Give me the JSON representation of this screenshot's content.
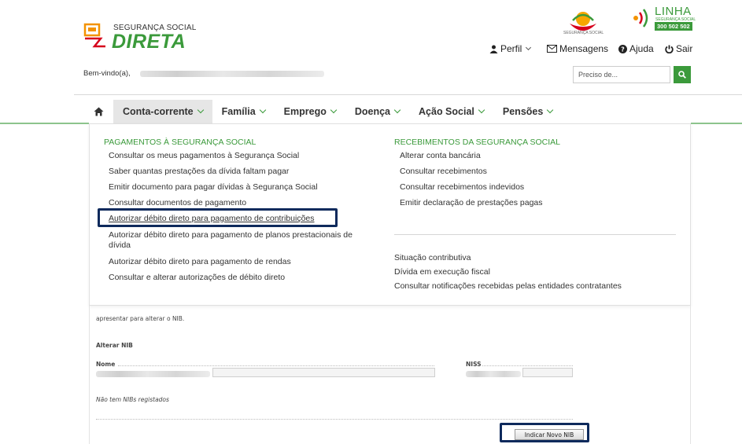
{
  "header": {
    "logo_top": "SEGURANÇA SOCIAL",
    "logo_main": "DIRETA",
    "emblem_label": "SEGURANÇA SOCIAL",
    "linha_title": "LINHA",
    "linha_sub": "SEGURANÇA SOCIAL",
    "linha_phone": "300 502 502",
    "profile": "Perfil",
    "messages": "Mensagens",
    "help": "Ajuda",
    "logout": "Sair",
    "welcome": "Bem-vindo(a),",
    "search_placeholder": "Preciso de...",
    "icons": {
      "profile": "user-icon",
      "messages": "envelope-icon",
      "help": "question-circle-icon",
      "logout": "power-icon",
      "search": "search-icon",
      "home": "home-icon"
    }
  },
  "nav": {
    "items": [
      {
        "label": "Conta-corrente",
        "active": true
      },
      {
        "label": "Família"
      },
      {
        "label": "Emprego"
      },
      {
        "label": "Doença"
      },
      {
        "label": "Ação Social"
      },
      {
        "label": "Pensões"
      }
    ]
  },
  "dropdown": {
    "left_heading": "PAGAMENTOS À SEGURANÇA SOCIAL",
    "left_links": [
      "Consultar os meus pagamentos à Segurança Social",
      "Saber quantas prestações da dívida faltam pagar",
      "Emitir documento para pagar dívidas à Segurança Social",
      "Consultar documentos de pagamento",
      "Autorizar débito direto para pagamento de contribuições",
      "Autorizar débito direto para pagamento de planos prestacionais de dívida",
      "Autorizar débito direto para pagamento de rendas",
      "Consultar e alterar autorizações de débito direto"
    ],
    "right_heading": "RECEBIMENTOS DA SEGURANÇA SOCIAL",
    "right_links": [
      "Alterar conta bancária",
      "Consultar recebimentos",
      "Consultar recebimentos indevidos",
      "Emitir declaração de prestações pagas"
    ],
    "right_links_2": [
      "Situação contributiva",
      "Dívida em execução fiscal",
      "Consultar notificações recebidas pelas entidades contratantes"
    ]
  },
  "page": {
    "intro_text": "apresentar para alterar o NIB.",
    "section_title": "Alterar NIB",
    "name_label": "Nome",
    "niss_label": "NISS",
    "no_nib": "Não tem NIBs registados",
    "new_nib_button": "Indicar Novo NIB"
  },
  "colors": {
    "brand_green": "#3b9a3b",
    "highlight_navy": "#0e2a5c"
  }
}
